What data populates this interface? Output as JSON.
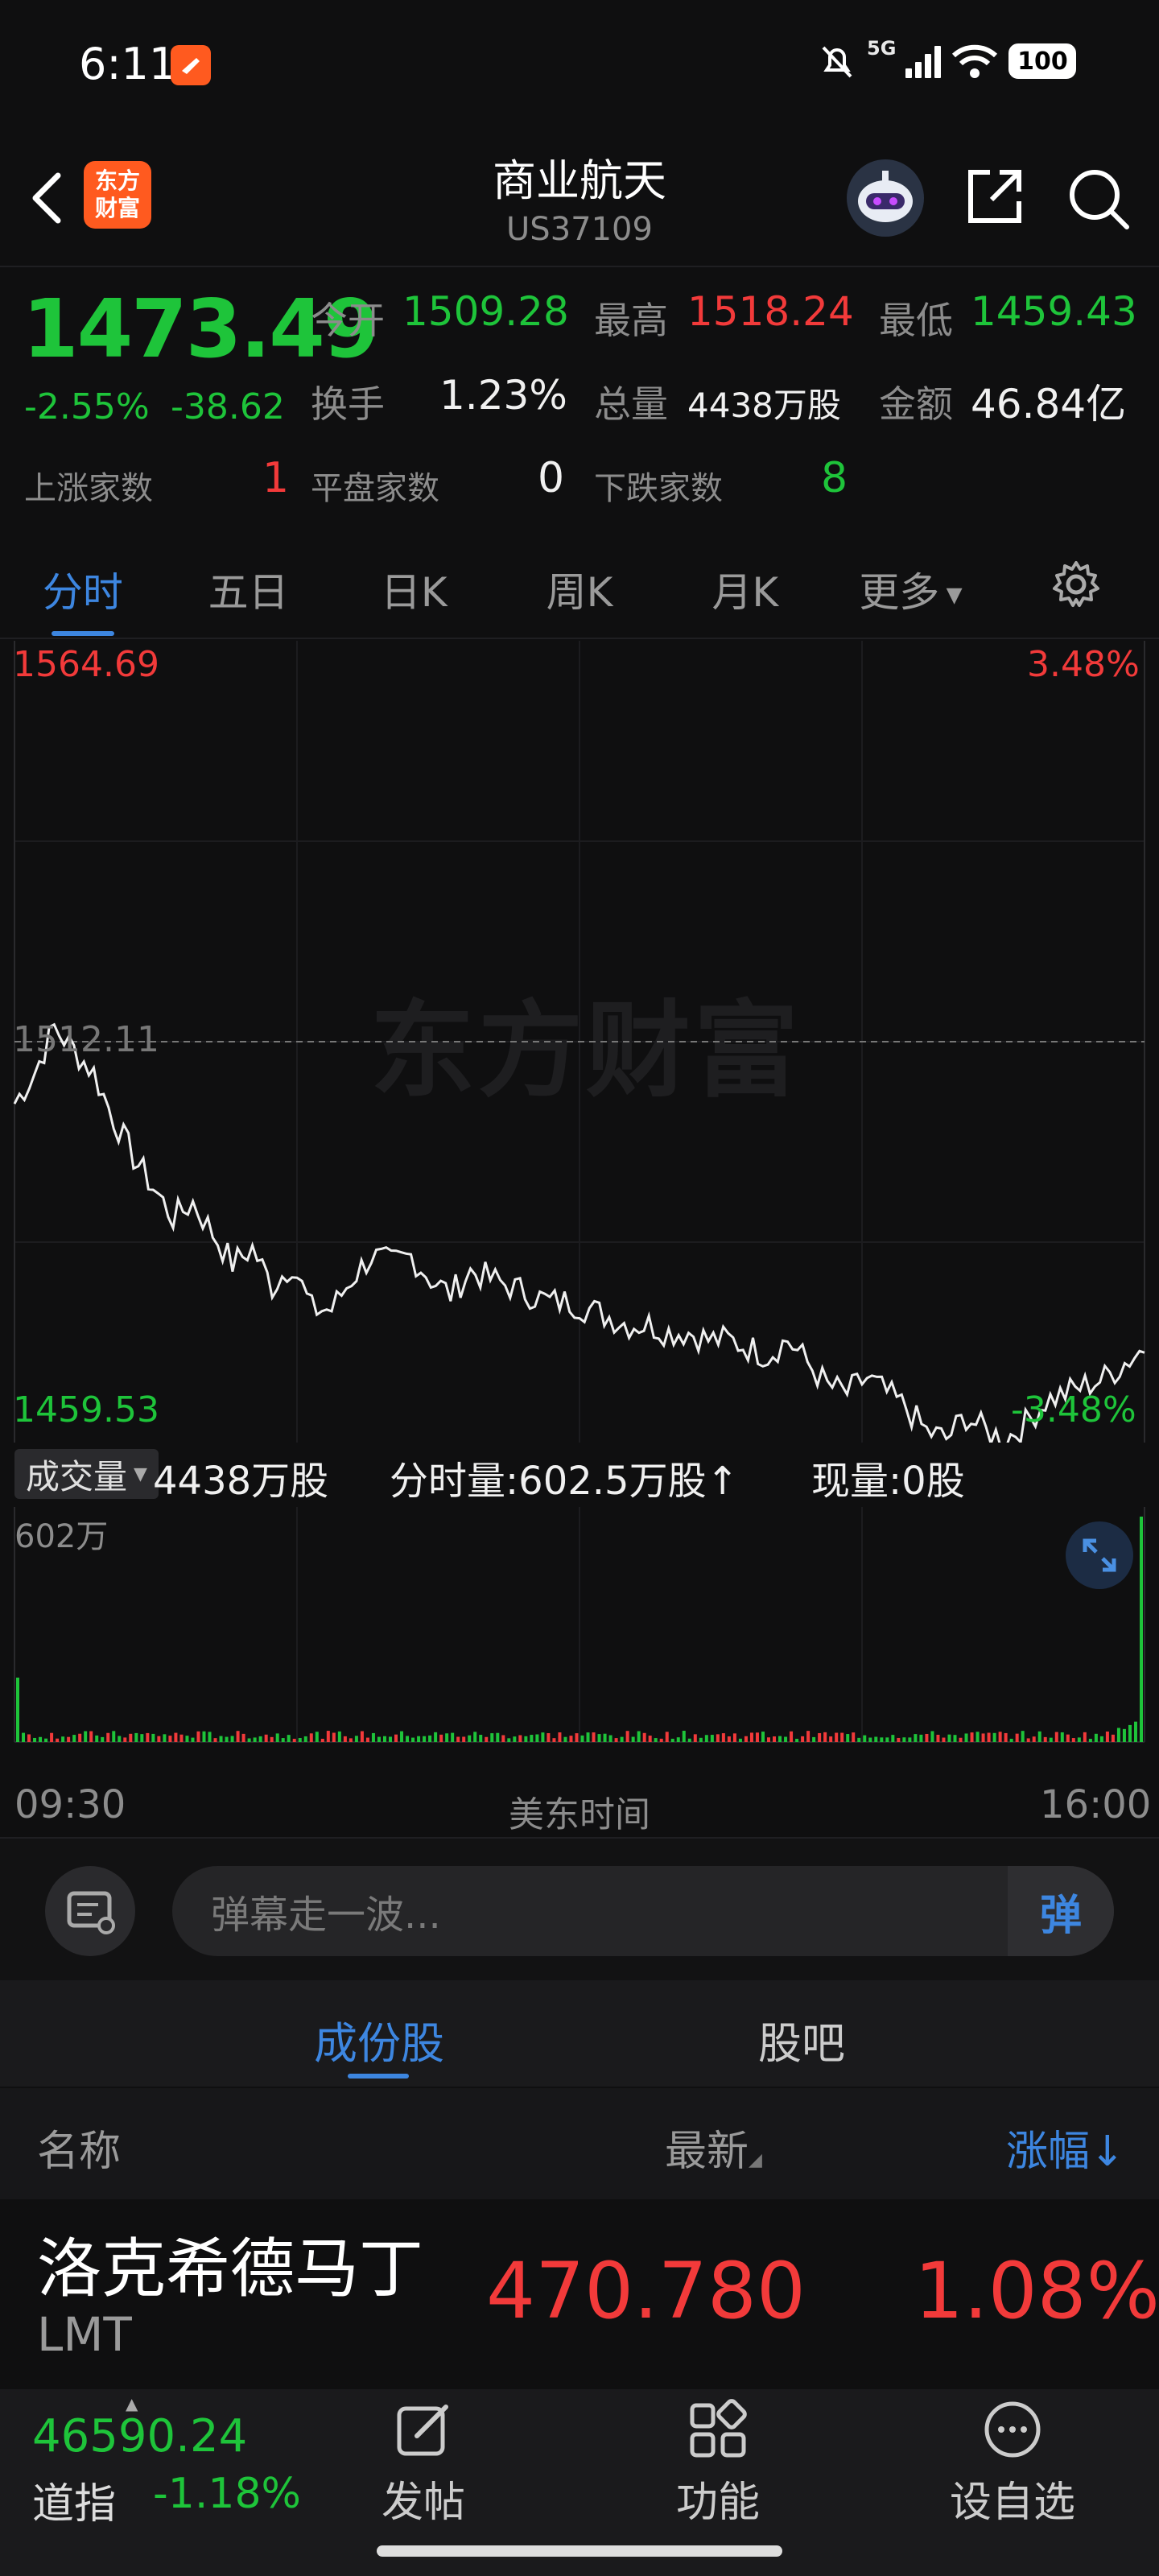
{
  "status_bar": {
    "time": "6:11",
    "network": "5G",
    "battery": "100"
  },
  "header": {
    "logo_line1": "东方",
    "logo_line2": "财富",
    "title": "商业航天",
    "code": "US37109"
  },
  "quote": {
    "price": "1473.49",
    "change_pct": "-2.55%",
    "change_amt": "-38.62",
    "open_label": "今开",
    "open": "1509.28",
    "high_label": "最高",
    "high": "1518.24",
    "low_label": "最低",
    "low": "1459.43",
    "turnover_label": "换手",
    "turnover": "1.23%",
    "volume_label": "总量",
    "volume": "4438万股",
    "amount_label": "金额",
    "amount": "46.84亿",
    "up_label": "上涨家数",
    "up": "1",
    "flat_label": "平盘家数",
    "flat": "0",
    "down_label": "下跌家数",
    "down": "8"
  },
  "chart_tabs": [
    "分时",
    "五日",
    "日K",
    "周K",
    "月K",
    "更多"
  ],
  "chart": {
    "top_price": "1564.69",
    "top_pct": "3.48%",
    "mid_price": "1512.11",
    "bottom_price": "1459.53",
    "bottom_pct": "-3.48%",
    "watermark": "东方财富",
    "colors": {
      "up": "#f23a3a",
      "down": "#1ec43a",
      "accent": "#3d86e0"
    }
  },
  "chart_data": {
    "type": "line",
    "ylim": [
      1459.53,
      1564.69
    ],
    "reference": 1512.11,
    "x": [
      "09:30",
      "16:00"
    ],
    "values": [
      1504,
      1508,
      1514,
      1511,
      1508,
      1502,
      1497,
      1493,
      1489,
      1491,
      1487,
      1483,
      1485,
      1480,
      1483,
      1477,
      1477,
      1481,
      1484,
      1483,
      1484,
      1481,
      1479,
      1482,
      1481,
      1480,
      1479,
      1478,
      1478,
      1477,
      1476,
      1475,
      1475,
      1474,
      1474,
      1473,
      1473,
      1472,
      1471,
      1473,
      1470,
      1467,
      1466,
      1468,
      1466,
      1464,
      1461,
      1460,
      1463,
      1461,
      1460,
      1462,
      1465,
      1466,
      1467,
      1468,
      1470,
      1472
    ],
    "volume": {
      "max_label": "602万",
      "unit": "万股"
    }
  },
  "volume_bar": {
    "selector": "成交量",
    "total": "4438万股",
    "minute": "分时量:602.5万股↑",
    "now": "现量:0股"
  },
  "time_axis": {
    "start": "09:30",
    "mid": "美东时间",
    "end": "16:00"
  },
  "danmaku": {
    "placeholder": "弹幕走一波...",
    "send": "弹"
  },
  "sub_tabs": [
    "成份股",
    "股吧"
  ],
  "list": {
    "headers": {
      "name": "名称",
      "latest": "最新",
      "change": "涨幅"
    },
    "rows": [
      {
        "name": "洛克希德马丁",
        "code": "LMT",
        "latest": "470.780",
        "change": "1.08%"
      }
    ]
  },
  "bottom_nav": {
    "index_value": "46590.24",
    "index_name": "道指",
    "index_change": "-1.18%",
    "post": "发帖",
    "features": "功能",
    "watchlist": "设自选"
  }
}
